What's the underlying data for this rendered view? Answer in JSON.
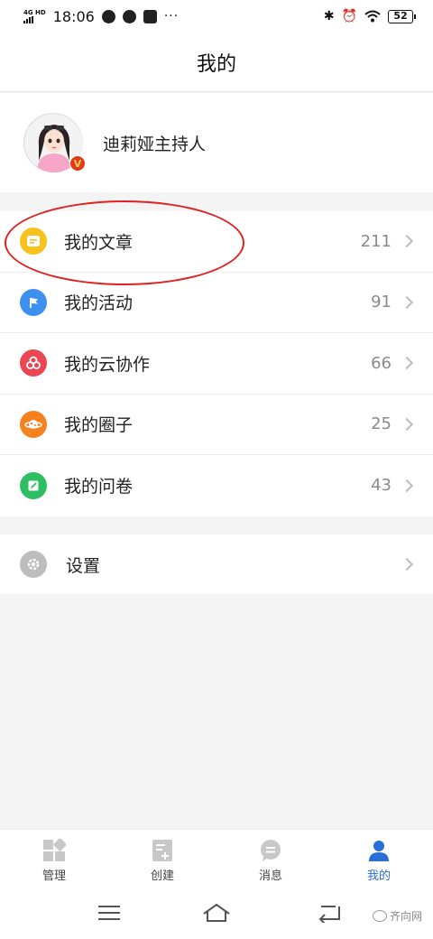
{
  "status_bar": {
    "network": "4G HD",
    "time": "18:06",
    "battery": "52"
  },
  "header": {
    "title": "我的"
  },
  "profile": {
    "name": "迪莉娅主持人",
    "badge": "V"
  },
  "list": [
    {
      "label": "我的文章",
      "count": "211",
      "icon": "article-icon",
      "color": "#f7c21b"
    },
    {
      "label": "我的活动",
      "count": "91",
      "icon": "flag-icon",
      "color": "#3d8ff0"
    },
    {
      "label": "我的云协作",
      "count": "66",
      "icon": "cloud-collab-icon",
      "color": "#ec4652"
    },
    {
      "label": "我的圈子",
      "count": "25",
      "icon": "planet-icon",
      "color": "#f5811f"
    },
    {
      "label": "我的问卷",
      "count": "43",
      "icon": "questionnaire-icon",
      "color": "#2dbf62"
    }
  ],
  "settings": {
    "label": "设置",
    "icon": "gear-icon",
    "color": "#bdbdbd"
  },
  "tabbar": {
    "tabs": [
      {
        "label": "管理",
        "icon": "grid-icon"
      },
      {
        "label": "创建",
        "icon": "create-doc-icon"
      },
      {
        "label": "消息",
        "icon": "message-icon"
      },
      {
        "label": "我的",
        "icon": "person-icon",
        "active": true
      }
    ],
    "active_color": "#2a6fd6"
  },
  "watermark": {
    "text": "齐向网"
  }
}
